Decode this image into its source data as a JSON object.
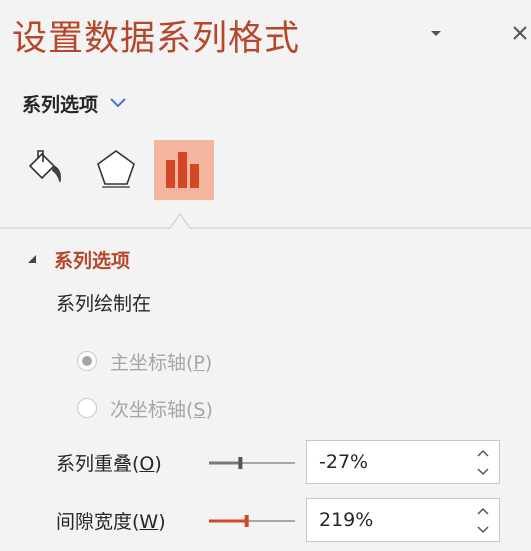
{
  "pane": {
    "title": "设置数据系列格式",
    "options_icon": "dropdown-caret-icon",
    "close_icon": "close-icon"
  },
  "series_options_menu": {
    "label": "系列选项",
    "chevron_icon": "chevron-down-icon"
  },
  "tabs": [
    {
      "icon": "paint-bucket-icon",
      "name": "Fill & Line"
    },
    {
      "icon": "pentagon-icon",
      "name": "Effects"
    },
    {
      "icon": "bar-chart-icon",
      "name": "Series Options",
      "selected": true
    }
  ],
  "section": {
    "title": "系列选项",
    "caret_icon": "collapse-triangle-icon",
    "plot_on_label": "系列绘制在",
    "radios": [
      {
        "label": "主坐标轴(",
        "key": "P",
        "suffix": ")",
        "checked": true,
        "disabled": true
      },
      {
        "label": "次坐标轴(",
        "key": "S",
        "suffix": ")",
        "checked": false,
        "disabled": true
      }
    ],
    "overlap": {
      "label": "系列重叠(",
      "key": "O",
      "suffix": ")",
      "value": "-27%",
      "slider_fraction": 0.365
    },
    "gap_width": {
      "label": "间隙宽度(",
      "key": "W",
      "suffix": ")",
      "value": "219%",
      "slider_fraction": 0.438
    }
  },
  "colors": {
    "accent": "#b7472a",
    "selected_tab_bg": "#f4b59f",
    "chart_icon": "#d24726",
    "panel_bg": "#f3f3f3",
    "disabled_text": "#a6a6a6"
  }
}
